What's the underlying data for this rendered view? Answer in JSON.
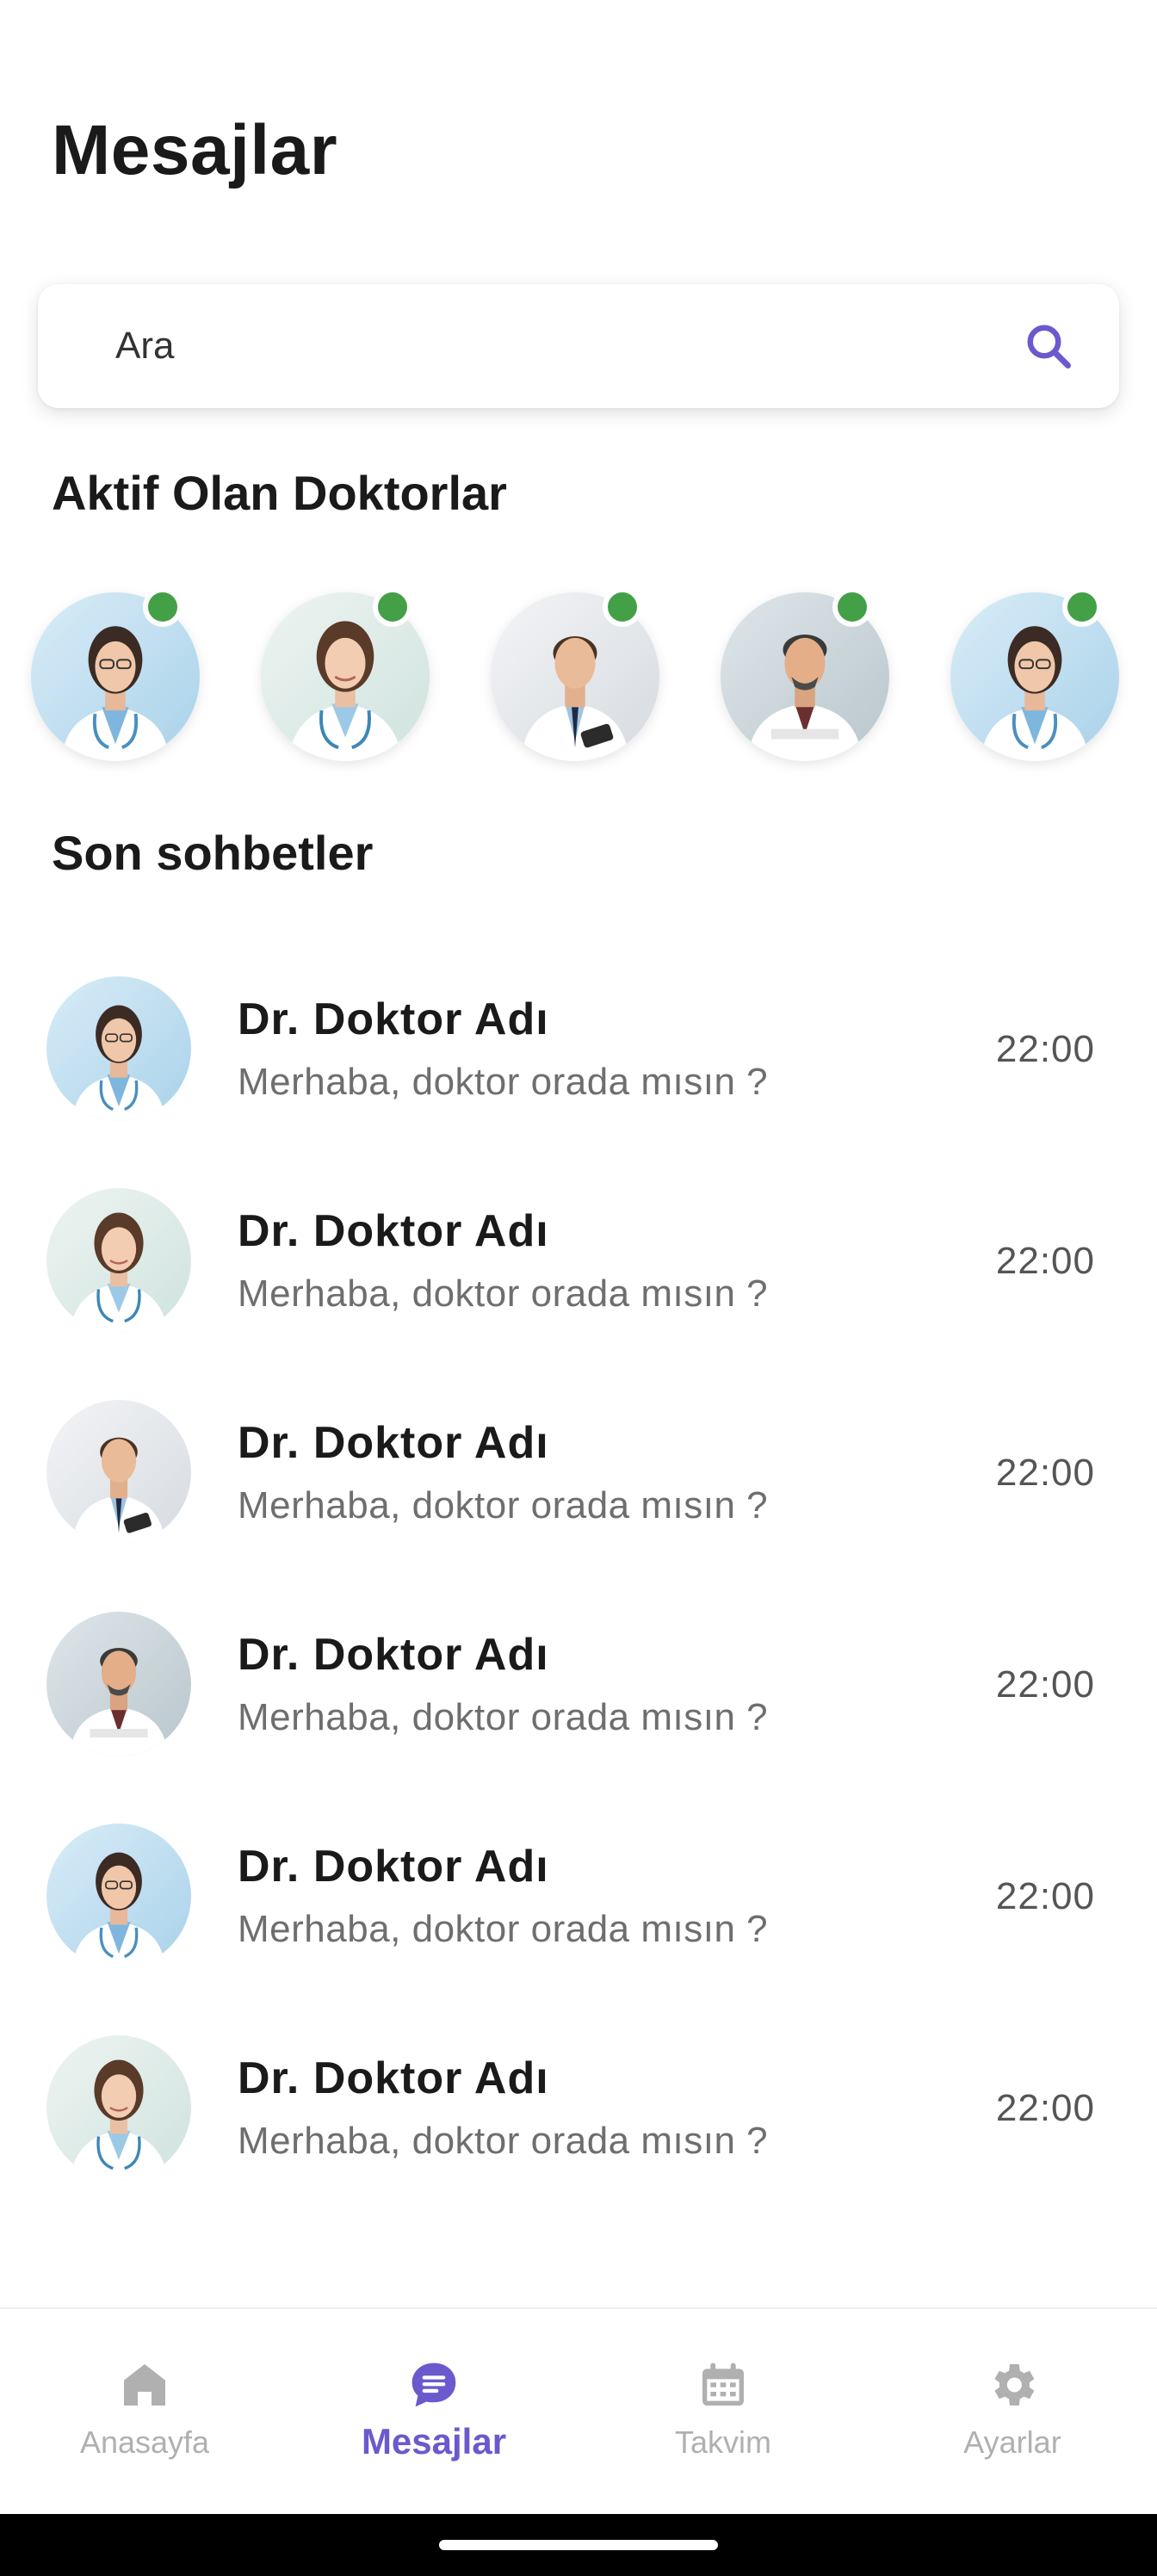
{
  "header": {
    "title": "Mesajlar"
  },
  "search": {
    "placeholder": "Ara",
    "icon": "search-icon",
    "icon_color": "#6a5acd"
  },
  "active_doctors": {
    "title": "Aktif Olan Doktorlar",
    "online_color": "#43a047",
    "items": [
      {
        "avatar": "doctor-avatar-1",
        "online": true
      },
      {
        "avatar": "doctor-avatar-2",
        "online": true
      },
      {
        "avatar": "doctor-avatar-3",
        "online": true
      },
      {
        "avatar": "doctor-avatar-4",
        "online": true
      },
      {
        "avatar": "doctor-avatar-1",
        "online": true
      }
    ]
  },
  "recent_chats": {
    "title": "Son sohbetler",
    "items": [
      {
        "avatar": "doctor-avatar-1",
        "name": "Dr. Doktor Adı",
        "message": "Merhaba, doktor orada mısın ?",
        "time": "22:00"
      },
      {
        "avatar": "doctor-avatar-2",
        "name": "Dr. Doktor Adı",
        "message": "Merhaba, doktor orada mısın ?",
        "time": "22:00"
      },
      {
        "avatar": "doctor-avatar-3",
        "name": "Dr. Doktor Adı",
        "message": "Merhaba, doktor orada mısın ?",
        "time": "22:00"
      },
      {
        "avatar": "doctor-avatar-4",
        "name": "Dr. Doktor Adı",
        "message": "Merhaba, doktor orada mısın ?",
        "time": "22:00"
      },
      {
        "avatar": "doctor-avatar-1",
        "name": "Dr. Doktor Adı",
        "message": "Merhaba, doktor orada mısın ?",
        "time": "22:00"
      },
      {
        "avatar": "doctor-avatar-2",
        "name": "Dr. Doktor Adı",
        "message": "Merhaba, doktor orada mısın ?",
        "time": "22:00"
      }
    ]
  },
  "bottom_nav": {
    "active_color": "#6a5acd",
    "inactive_color": "#b0b0b0",
    "items": [
      {
        "label": "Anasayfa",
        "icon": "home-icon",
        "active": false
      },
      {
        "label": "Mesajlar",
        "icon": "chat-bubble-icon",
        "active": true
      },
      {
        "label": "Takvim",
        "icon": "calendar-icon",
        "active": false
      },
      {
        "label": "Ayarlar",
        "icon": "gear-icon",
        "active": false
      }
    ]
  }
}
